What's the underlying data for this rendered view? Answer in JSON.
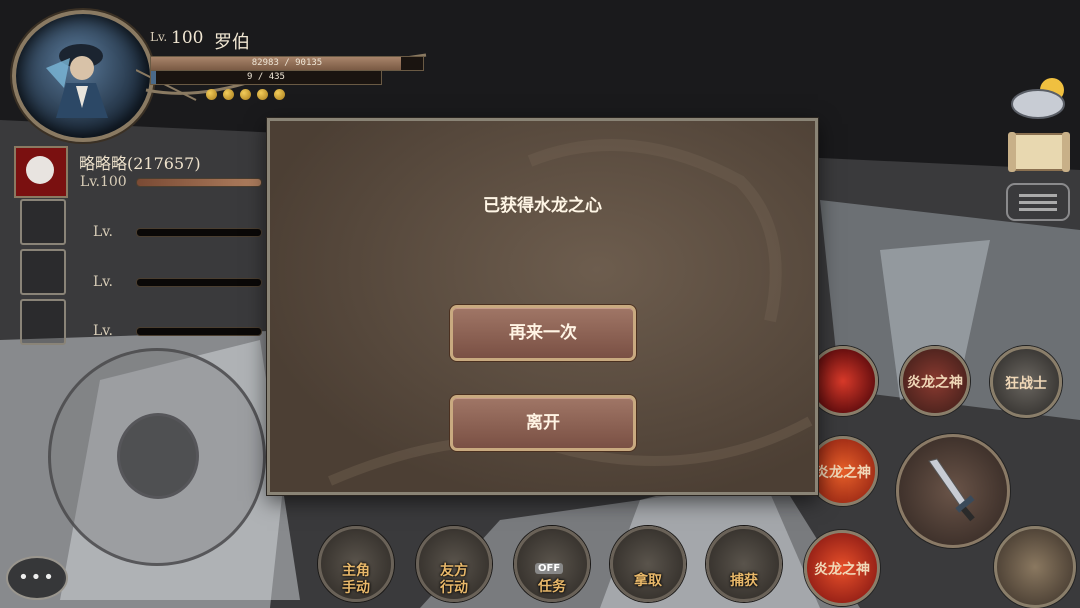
{
  "player": {
    "lv_prefix": "Lv.",
    "level": "100",
    "name": "罗伯",
    "hp_text": "82983 / 90135",
    "hp_fraction": 0.92,
    "mp_text": "9 / 435",
    "mp_fraction": 0.02,
    "stars": 5
  },
  "party": {
    "leader_name": "略略略(217657)",
    "leader_level": "Lv.100",
    "empty_slot_level": "Lv.",
    "empty_slots": 3
  },
  "modal": {
    "title": "已获得水龙之心",
    "retry_label": "再来一次",
    "leave_label": "离开"
  },
  "skills": {
    "fire_dragon_label": "炎龙之神",
    "berserker_label": "狂战士"
  },
  "actions": {
    "lead_manual": "主角\n手动",
    "ally_action": "友方\n行动",
    "quest": "任务",
    "quest_toggle": "OFF",
    "grab": "拿取",
    "capture": "捕获"
  },
  "icons": {
    "weather": "cloudy-sun-icon",
    "map": "scroll-map-icon",
    "chat": "chat-log-icon",
    "attack": "sword-icon"
  }
}
